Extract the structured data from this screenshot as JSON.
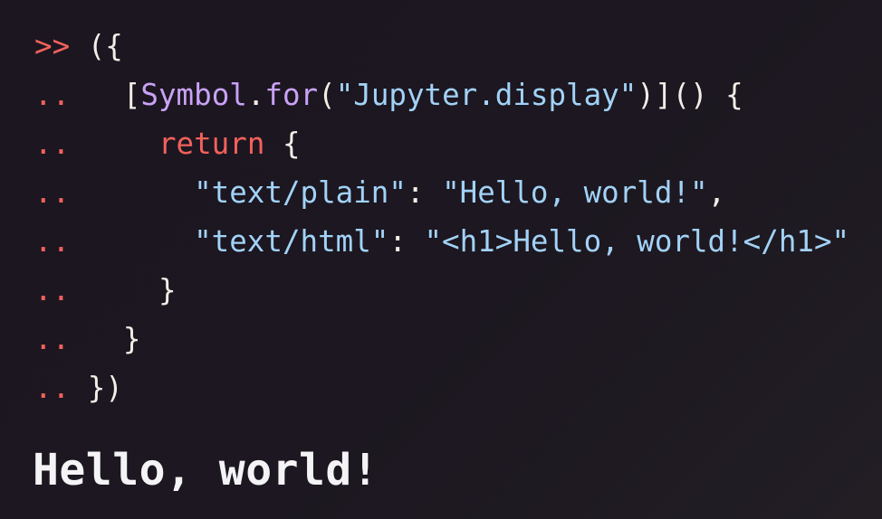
{
  "colors": {
    "prompt": "#f2615b",
    "plain": "#f2eee6",
    "keyword": "#f2615b",
    "func": "#c9a2f7",
    "string": "#a2d2f7",
    "background": "#1c1720"
  },
  "repl": {
    "lines": [
      {
        "prompt": ">>",
        "tokens": [
          {
            "type": "plain",
            "text": " ({"
          }
        ]
      },
      {
        "prompt": "..",
        "tokens": [
          {
            "type": "plain",
            "text": "   ["
          },
          {
            "type": "func",
            "text": "Symbol"
          },
          {
            "type": "plain",
            "text": "."
          },
          {
            "type": "func",
            "text": "for"
          },
          {
            "type": "plain",
            "text": "("
          },
          {
            "type": "string",
            "text": "\"Jupyter.display\""
          },
          {
            "type": "plain",
            "text": ")]() {"
          }
        ]
      },
      {
        "prompt": "..",
        "tokens": [
          {
            "type": "plain",
            "text": "     "
          },
          {
            "type": "keyword",
            "text": "return"
          },
          {
            "type": "plain",
            "text": " {"
          }
        ]
      },
      {
        "prompt": "..",
        "tokens": [
          {
            "type": "plain",
            "text": "       "
          },
          {
            "type": "string",
            "text": "\"text/plain\""
          },
          {
            "type": "plain",
            "text": ": "
          },
          {
            "type": "string",
            "text": "\"Hello, world!\""
          },
          {
            "type": "plain",
            "text": ","
          }
        ]
      },
      {
        "prompt": "..",
        "tokens": [
          {
            "type": "plain",
            "text": "       "
          },
          {
            "type": "string",
            "text": "\"text/html\""
          },
          {
            "type": "plain",
            "text": ": "
          },
          {
            "type": "string",
            "text": "\"<h1>Hello, world!</h1>\""
          }
        ]
      },
      {
        "prompt": "..",
        "tokens": [
          {
            "type": "plain",
            "text": "     }"
          }
        ]
      },
      {
        "prompt": "..",
        "tokens": [
          {
            "type": "plain",
            "text": "   }"
          }
        ]
      },
      {
        "prompt": "..",
        "tokens": [
          {
            "type": "plain",
            "text": " })"
          }
        ]
      }
    ]
  },
  "output": {
    "heading": "Hello, world!"
  }
}
